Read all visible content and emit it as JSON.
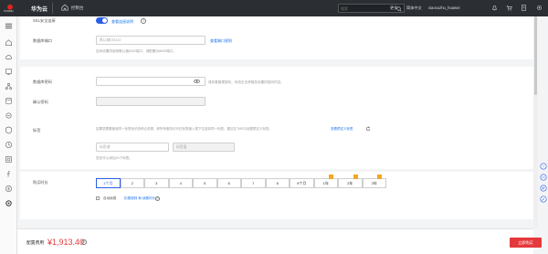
{
  "topbar": {
    "logo_text": "HUAWEI",
    "brand": "华为云",
    "console": "控制台",
    "search_placeholder": "搜索",
    "more": "更多",
    "lang": "简体中文",
    "user": "xiaoxuzhu_huawei"
  },
  "form": {
    "ssl_label": "SSL安全连接",
    "ssl_link": "查看连接说明",
    "port_label": "数据库端口",
    "port_placeholder": "默认端口5432",
    "port_link": "查看端口规则",
    "port_hint": "如未设置则使用默认值5432端口，请配置为8635端口。",
    "password_label": "数据库密码",
    "password_hint": "请妥善管理密码，系统无法获取您设置的密码内容。",
    "confirm_label": "确认密码",
    "tags_label": "标签",
    "tags_desc": "如果您需要使用同一标签标识多种云资源，即所有服务均可在标签输入框下拉选择同一标签，建议在TMS中创建预定义标签。",
    "tags_link": "查看预定义标签",
    "tag_key_placeholder": "标签键",
    "tag_value_placeholder": "标签值",
    "tags_hint": "您还可以添加10个标签。",
    "duration_label": "购买时长",
    "durations": [
      "1个月",
      "2",
      "3",
      "4",
      "5",
      "6",
      "7",
      "8",
      "9个月",
      "1年",
      "2年",
      "3年"
    ],
    "auto_renew": "自动续费",
    "renew_links": "扣费规则 和 续费时长"
  },
  "footer": {
    "fee_label": "配置费用",
    "fee_value": "¥1,913.40",
    "buy_label": "立即购买"
  },
  "colors": {
    "accent": "#2a5ee8",
    "price": "#e4393c",
    "topbar": "#2b2e33"
  }
}
